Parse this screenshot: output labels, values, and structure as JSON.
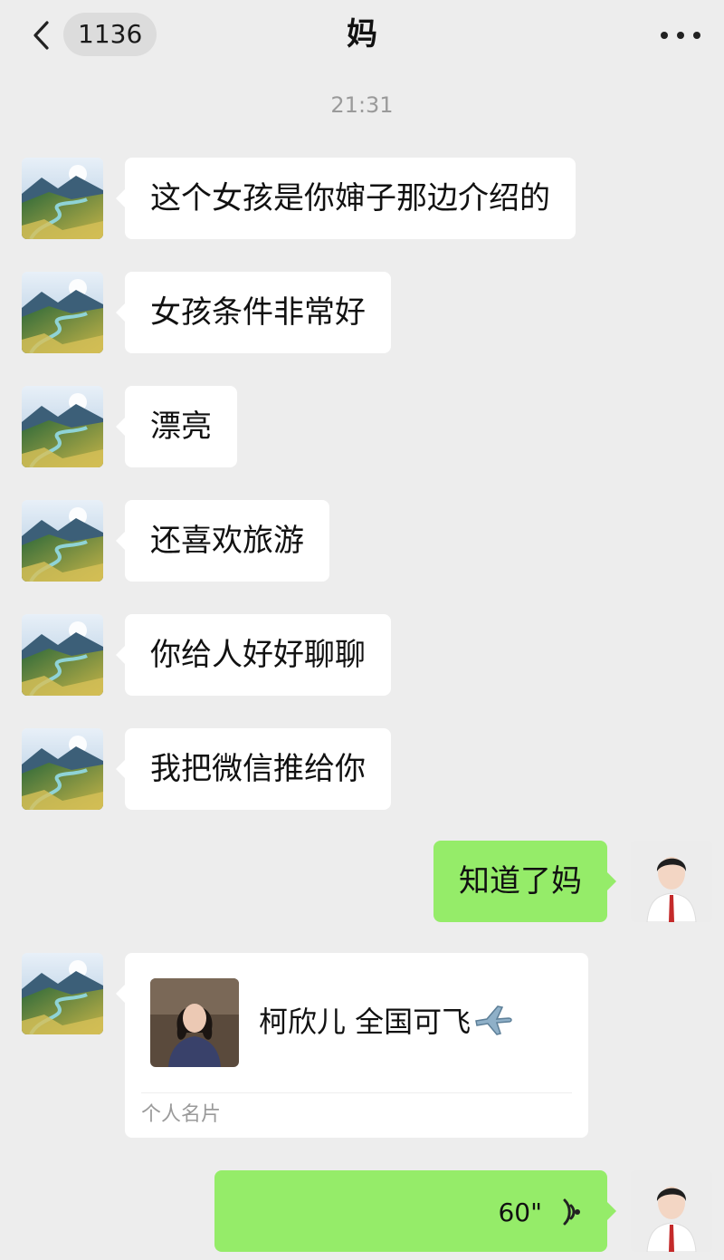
{
  "nav": {
    "unread_count": "1136",
    "title": "妈",
    "back_icon": "chevron-left-icon",
    "more_icon": "more-dots-icon"
  },
  "timestamp": "21:31",
  "messages": [
    {
      "from": "mom",
      "text": "这个女孩是你婶子那边介绍的"
    },
    {
      "from": "mom",
      "text": "女孩条件非常好"
    },
    {
      "from": "mom",
      "text": "漂亮"
    },
    {
      "from": "mom",
      "text": "还喜欢旅游"
    },
    {
      "from": "mom",
      "text": "你给人好好聊聊"
    },
    {
      "from": "mom",
      "text": "我把微信推给你"
    },
    {
      "from": "me",
      "text": "知道了妈"
    }
  ],
  "contact_card": {
    "from": "mom",
    "name": "柯欣儿 全国可飞",
    "label": "个人名片",
    "emoji_icon": "airplane-icon"
  },
  "voice_message": {
    "from": "me",
    "duration": "60\"",
    "icon": "voice-wave-icon"
  },
  "colors": {
    "background": "#ededed",
    "outgoing_bubble": "#95ec69",
    "incoming_bubble": "#ffffff"
  }
}
